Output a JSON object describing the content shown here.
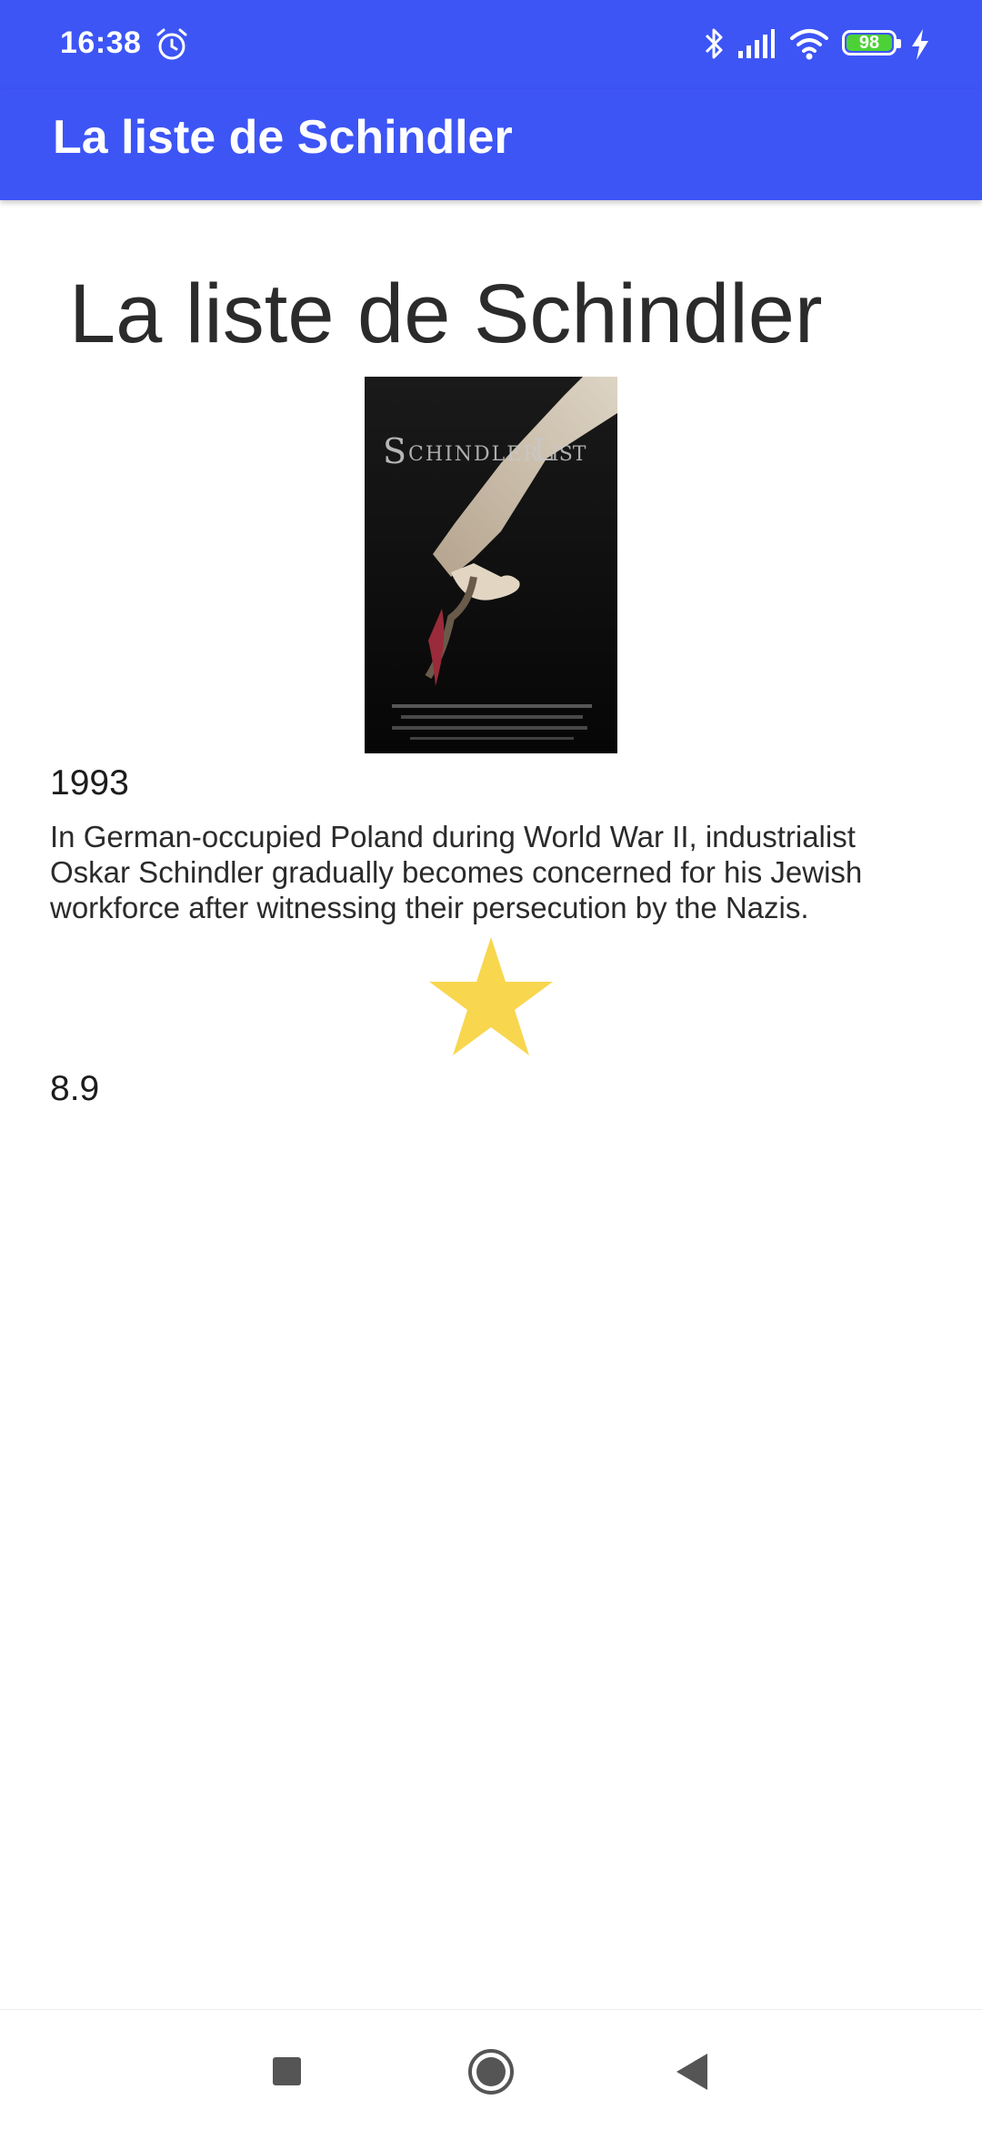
{
  "status_bar": {
    "time": "16:38",
    "battery_level": "98",
    "icons": [
      "alarm-icon",
      "bluetooth-icon",
      "signal-icon",
      "wifi-icon",
      "battery-icon",
      "charging-icon"
    ]
  },
  "toolbar": {
    "title": "La liste de Schindler"
  },
  "movie": {
    "title": "La liste de Schindler",
    "poster_alt": "Schindler's List poster",
    "year": "1993",
    "overview": "In German-occupied Poland during World War II, industrialist Oskar Schindler gradually becomes concerned for his Jewish workforce after witnessing their persecution by the Nazis.",
    "rating": "8.9",
    "rating_icon": "star-icon"
  },
  "colors": {
    "primary": "#3d55f5",
    "star": "#f8d64e",
    "battery": "#4cd137"
  },
  "nav_bar": {
    "icons": [
      "recent-apps-icon",
      "home-icon",
      "back-icon"
    ]
  }
}
